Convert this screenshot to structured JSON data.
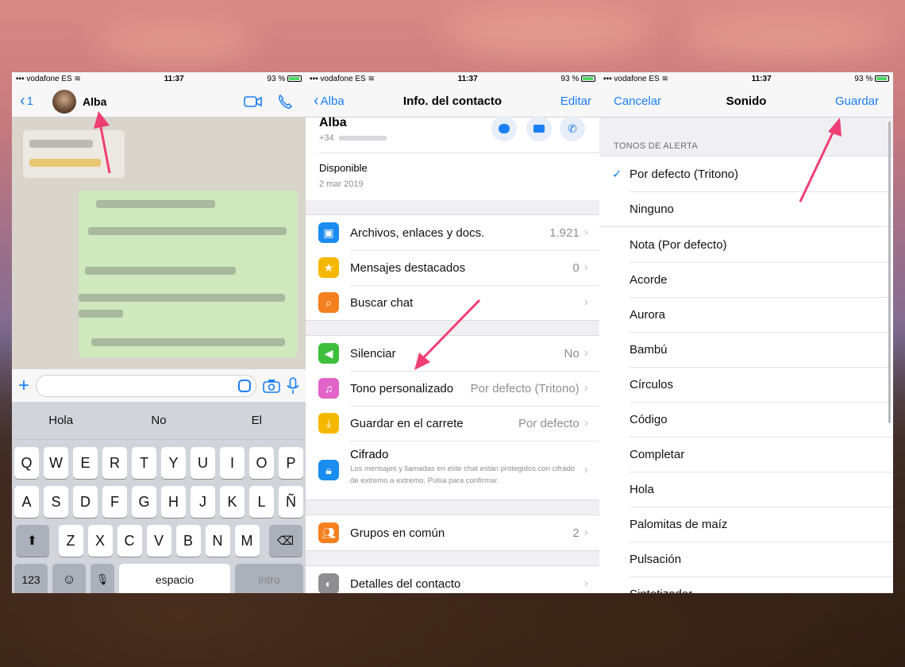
{
  "status_bar": {
    "carrier": "vodafone ES",
    "time": "11:37",
    "battery": "93 %"
  },
  "chat": {
    "back_count": "1",
    "contact_name": "Alba",
    "suggestions": [
      "Hola",
      "No",
      "El"
    ],
    "keyboard": {
      "row1": [
        "Q",
        "W",
        "E",
        "R",
        "T",
        "Y",
        "U",
        "I",
        "O",
        "P"
      ],
      "row2": [
        "A",
        "S",
        "D",
        "F",
        "G",
        "H",
        "J",
        "K",
        "L",
        "Ñ"
      ],
      "row3": [
        "Z",
        "X",
        "C",
        "V",
        "B",
        "N",
        "M"
      ],
      "key_123": "123",
      "space": "espacio",
      "return": "intro"
    }
  },
  "contact_info": {
    "back_label": "Alba",
    "title": "Info. del contacto",
    "edit_label": "Editar",
    "name": "Alba",
    "phone_prefix": "+34",
    "status": "Disponible",
    "status_date": "2 mar 2019",
    "group1": [
      {
        "label": "Archivos, enlaces y docs.",
        "value": "1.921",
        "icon": "photo-icon",
        "color": "#1b8cf0"
      },
      {
        "label": "Mensajes destacados",
        "value": "0",
        "icon": "star-icon",
        "color": "#f5b800"
      },
      {
        "label": "Buscar chat",
        "value": "",
        "icon": "search-icon",
        "color": "#f5801f"
      }
    ],
    "group2": [
      {
        "label": "Silenciar",
        "value": "No",
        "icon": "speaker-icon",
        "color": "#3dbf3d"
      },
      {
        "label": "Tono personalizado",
        "value": "Por defecto (Tritono)",
        "icon": "music-note-icon",
        "color": "#e264c8"
      },
      {
        "label": "Guardar en el carrete",
        "value": "Por defecto",
        "icon": "download-icon",
        "color": "#f5b800"
      }
    ],
    "encryption": {
      "label": "Cifrado",
      "description": "Los mensajes y llamadas en este chat están protegidos con cifrado de extremo a extremo. Pulsa para confirmar."
    },
    "groups_common": {
      "label": "Grupos en común",
      "value": "2"
    },
    "contact_details": {
      "label": "Detalles del contacto"
    }
  },
  "sound": {
    "cancel_label": "Cancelar",
    "title": "Sonido",
    "save_label": "Guardar",
    "section_header": "TONOS DE ALERTA",
    "top_items": [
      "Por defecto (Tritono)",
      "Ninguno"
    ],
    "selected_index": 0,
    "tones": [
      "Nota (Por defecto)",
      "Acorde",
      "Aurora",
      "Bambú",
      "Círculos",
      "Código",
      "Completar",
      "Hola",
      "Palomitas de maíz",
      "Pulsación",
      "Sintetizador"
    ]
  },
  "colors": {
    "ios_blue": "#1a7ef5",
    "arrow_pink": "#ef3e74",
    "bubble_green": "#dcf8c6"
  }
}
